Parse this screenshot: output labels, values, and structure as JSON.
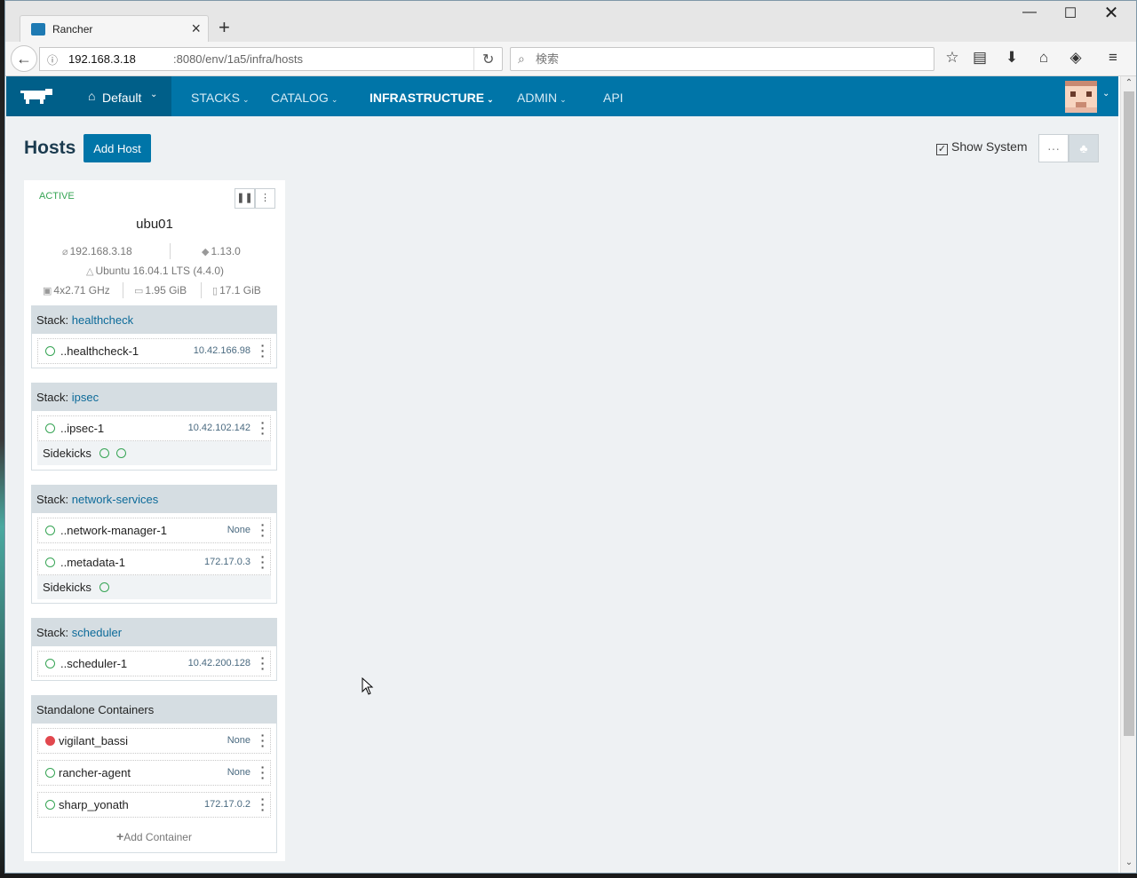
{
  "browser": {
    "tab_title": "Rancher",
    "url_host": "192.168.3.18",
    "url_rest": ":8080/env/1a5/infra/hosts",
    "search_placeholder": "検索"
  },
  "header": {
    "environment": "Default",
    "menu": [
      "STACKS",
      "CATALOG",
      "INFRASTRUCTURE",
      "ADMIN",
      "API"
    ]
  },
  "page": {
    "title": "Hosts",
    "add_host_label": "Add Host",
    "show_system_label": "Show System",
    "show_system_checked": true
  },
  "host": {
    "state": "ACTIVE",
    "name": "ubu01",
    "ip": "192.168.3.18",
    "docker_version": "1.13.0",
    "os": "Ubuntu 16.04.1 LTS (4.4.0)",
    "cpu": "4x2.71 GHz",
    "memory": "1.95 GiB",
    "storage": "17.1 GiB",
    "stack_prefix": "Stack: ",
    "stacks": [
      {
        "name": "healthcheck",
        "containers": [
          {
            "name": "..healthcheck-1",
            "ip": "10.42.166.98"
          }
        ]
      },
      {
        "name": "ipsec",
        "containers": [
          {
            "name": "..ipsec-1",
            "ip": "10.42.102.142"
          }
        ],
        "sidekicks_label": "Sidekicks",
        "sidekicks": 2
      },
      {
        "name": "network-services",
        "containers": [
          {
            "name": "..network-manager-1",
            "ip": "None"
          },
          {
            "name": "..metadata-1",
            "ip": "172.17.0.3"
          }
        ],
        "sidekicks_label": "Sidekicks",
        "sidekicks": 1
      },
      {
        "name": "scheduler",
        "containers": [
          {
            "name": "..scheduler-1",
            "ip": "10.42.200.128"
          }
        ]
      }
    ],
    "standalone": {
      "title": "Standalone Containers",
      "containers": [
        {
          "name": "vigilant_bassi",
          "ip": "None",
          "state": "error"
        },
        {
          "name": "rancher-agent",
          "ip": "None",
          "state": "running"
        },
        {
          "name": "sharp_yonath",
          "ip": "172.17.0.2",
          "state": "running"
        }
      ],
      "add_label": "Add Container"
    }
  },
  "colors": {
    "brand": "#0075a8",
    "brand_dark": "#005f89",
    "active": "#36a454",
    "error": "#e2484e"
  }
}
